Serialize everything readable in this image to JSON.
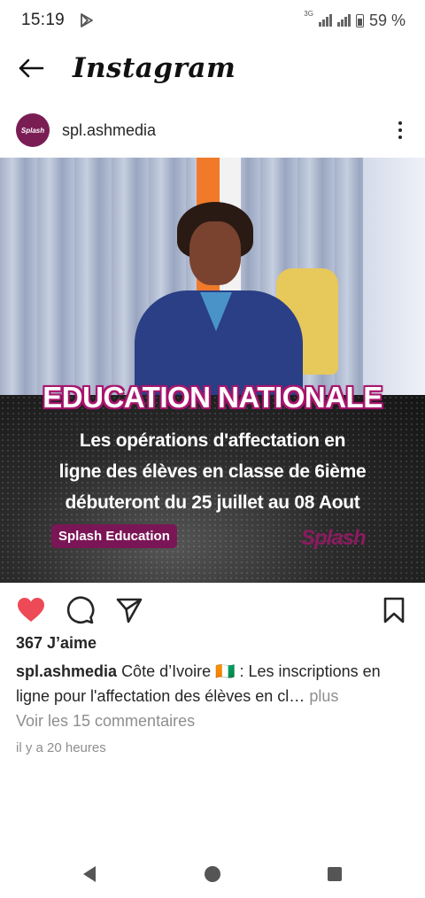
{
  "status_bar": {
    "time": "15:19",
    "network": "3G",
    "battery": "59 %"
  },
  "header": {
    "app_name": "Instagram"
  },
  "post": {
    "username": "spl.ashmedia",
    "avatar_text": "Splash",
    "image": {
      "headline": "EDUCATION NATIONALE",
      "lines": [
        "Les opérations d'affectation en",
        "ligne des élèves en classe de 6ième",
        "débuteront du 25 juillet au 08 Aout"
      ],
      "tag": "Splash Education",
      "watermark": "Splash"
    },
    "likes": "367 J’aime",
    "caption_user": "spl.ashmedia",
    "caption_text": "Côte d’Ivoire 🇨🇮 : Les inscriptions en ligne pour l'affectation des élèves en cl…",
    "caption_more": "plus",
    "comments_link": "Voir les 15 commentaires",
    "time_ago": "il y a 20 heures"
  },
  "colors": {
    "like_red": "#ed4956",
    "brand_purple": "#7b1656"
  }
}
